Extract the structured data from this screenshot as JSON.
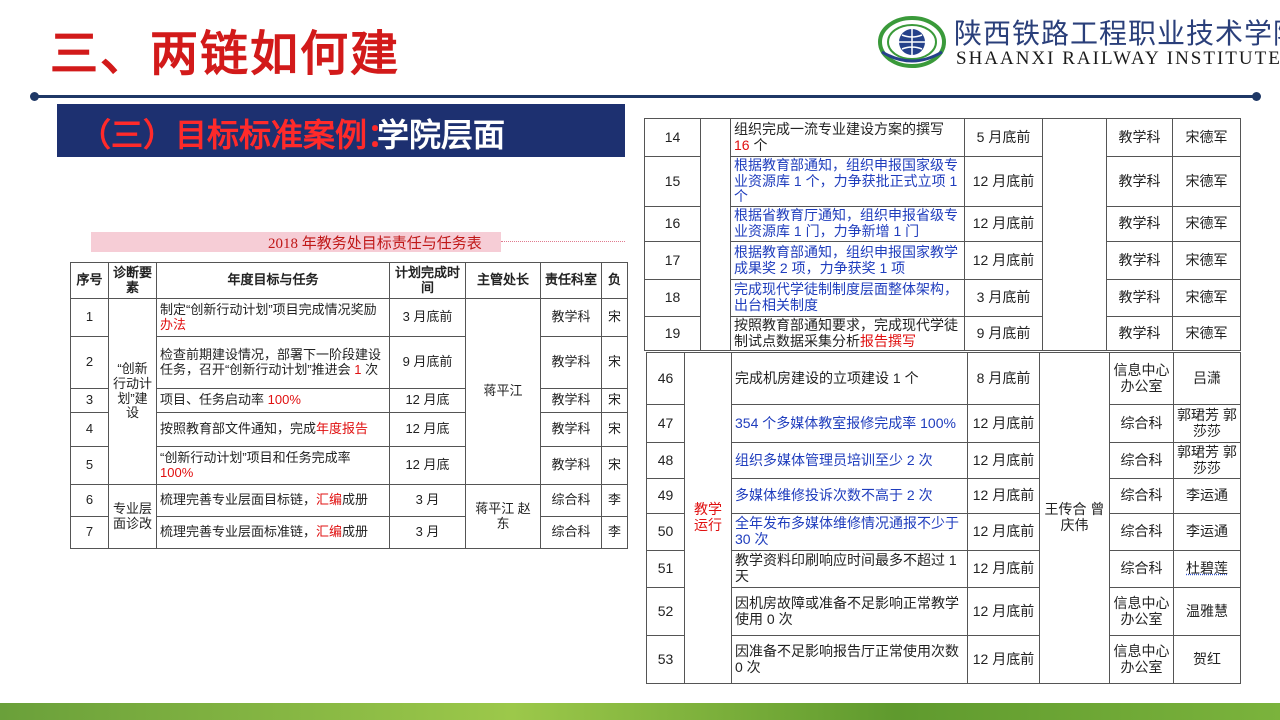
{
  "slide": {
    "title": "三、两链如何建",
    "subtitle_part1": "（三）目标标准案例：",
    "subtitle_part2": "学院层面",
    "table_caption": "2018 年教务处目标责任与任务表"
  },
  "logo": {
    "cn": "陕西铁路工程职业技术学院",
    "en": "SHAANXI RAILWAY INSTITUTE"
  },
  "colors": {
    "title_red": "#d21a1a",
    "navy": "#1d3070",
    "text_blue": "#1f3dbd",
    "highlight_red": "#e01010",
    "bottom_green": "#7bb33c"
  },
  "table1": {
    "headers": [
      "序号",
      "诊断要素",
      "年度目标与任务",
      "计划完成时间",
      "主管处长",
      "责任科室",
      "负"
    ],
    "groups": {
      "innovation": "“创新行动计划”建设",
      "major": "专业层面诊改",
      "head_a": "蒋平江",
      "head_b": "蒋平江 赵东"
    },
    "rows": [
      {
        "no": "1",
        "task": "制定“创新行动计划”项目完成情况奖励",
        "task_red": "办法",
        "task_tail": "",
        "time": "3 月底前",
        "dept": "教学科",
        "person": "宋"
      },
      {
        "no": "2",
        "task": "检查前期建设情况，部署下一阶段建设任务，召开“创新行动计划”推进会 ",
        "task_red": "1",
        "task_tail": " 次",
        "time": "9 月底前",
        "dept": "教学科",
        "person": "宋"
      },
      {
        "no": "3",
        "task": "项目、任务启动率 ",
        "task_red": "100%",
        "task_tail": "",
        "time": "12 月底",
        "dept": "教学科",
        "person": "宋"
      },
      {
        "no": "4",
        "task": "按照教育部文件通知，完成",
        "task_red": "年度报告",
        "task_tail": "",
        "time": "12 月底",
        "dept": "教学科",
        "person": "宋"
      },
      {
        "no": "5",
        "task": "“创新行动计划”项目和任务完成率 ",
        "task_red": "100%",
        "task_tail": "",
        "time": "12 月底",
        "dept": "教学科",
        "person": "宋"
      },
      {
        "no": "6",
        "task": "梳理完善专业层面目标链，",
        "task_red": "汇编",
        "task_tail": "成册",
        "time": "3 月",
        "dept": "综合科",
        "person": "李"
      },
      {
        "no": "7",
        "task": "梳理完善专业层面标准链，",
        "task_red": "汇编",
        "task_tail": "成册",
        "time": "3 月",
        "dept": "综合科",
        "person": "李"
      }
    ]
  },
  "table2": {
    "rows": [
      {
        "no": "14",
        "task": "组织完成一流专业建设方案的撰写 ",
        "task_red": "16",
        "task_tail": " 个",
        "task_color": "black",
        "time": "5 月底前",
        "dept": "教学科",
        "person": "宋德军"
      },
      {
        "no": "15",
        "task": "根据教育部通知，组织申报国家级专业资源库 1 个，力争获批正式立项 1 个",
        "task_red": "",
        "task_tail": "",
        "task_color": "blue",
        "time": "12 月底前",
        "dept": "教学科",
        "person": "宋德军"
      },
      {
        "no": "16",
        "task": "根据省教育厅通知，组织申报省级专业资源库 1 门，力争新增 1 门",
        "task_red": "",
        "task_tail": "",
        "task_color": "blue",
        "time": "12 月底前",
        "dept": "教学科",
        "person": "宋德军"
      },
      {
        "no": "17",
        "task": "根据教育部通知，组织申报国家教学成果奖 2 项，力争获奖 1 项",
        "task_red": "",
        "task_tail": "",
        "task_color": "blue",
        "time": "12 月底前",
        "dept": "教学科",
        "person": "宋德军"
      },
      {
        "no": "18",
        "task": "完成现代学徒制制度层面整体架构，出台相关制度",
        "task_red": "",
        "task_tail": "",
        "task_color": "blue",
        "time": "3 月底前",
        "dept": "教学科",
        "person": "宋德军"
      },
      {
        "no": "19",
        "task": "按照教育部通知要求，完成现代学徒制试点数据采集分析",
        "task_red": "报告撰写",
        "task_tail": "",
        "task_color": "black",
        "time": "9 月底前",
        "dept": "教学科",
        "person": "宋德军"
      }
    ]
  },
  "table3": {
    "group": "教学运行",
    "head": "王传合 曾庆伟",
    "rows": [
      {
        "no": "46",
        "task": "完成机房建设的立项建设 1 个",
        "task_color": "black",
        "time": "8 月底前",
        "dept": "信息中心办公室",
        "person": "吕潇"
      },
      {
        "no": "47",
        "task": "354 个多媒体教室报修完成率 100%",
        "task_color": "blue",
        "time": "12 月底前",
        "dept": "综合科",
        "person": "郭珺芳 郭莎莎"
      },
      {
        "no": "48",
        "task": "组织多媒体管理员培训至少 2 次",
        "task_color": "blue",
        "time": "12 月底前",
        "dept": "综合科",
        "person": "郭珺芳 郭莎莎"
      },
      {
        "no": "49",
        "task": "多媒体维修投诉次数不高于 2 次",
        "task_color": "blue",
        "time": "12 月底前",
        "dept": "综合科",
        "person": "李运通"
      },
      {
        "no": "50",
        "task": "全年发布多媒体维修情况通报不少于 30 次",
        "task_color": "blue",
        "time": "12 月底前",
        "dept": "综合科",
        "person": "李运通"
      },
      {
        "no": "51",
        "task": "教学资料印刷响应时间最多不超过 1 天",
        "task_color": "black",
        "time": "12 月底前",
        "dept": "综合科",
        "person": "杜碧莲"
      },
      {
        "no": "52",
        "task": "因机房故障或准备不足影响正常教学使用 0 次",
        "task_color": "black",
        "time": "12 月底前",
        "dept": "信息中心办公室",
        "person": "温雅慧"
      },
      {
        "no": "53",
        "task": "因准备不足影响报告厅正常使用次数 0 次",
        "task_color": "black",
        "time": "12 月底前",
        "dept": "信息中心办公室",
        "person": "贺红"
      }
    ]
  }
}
